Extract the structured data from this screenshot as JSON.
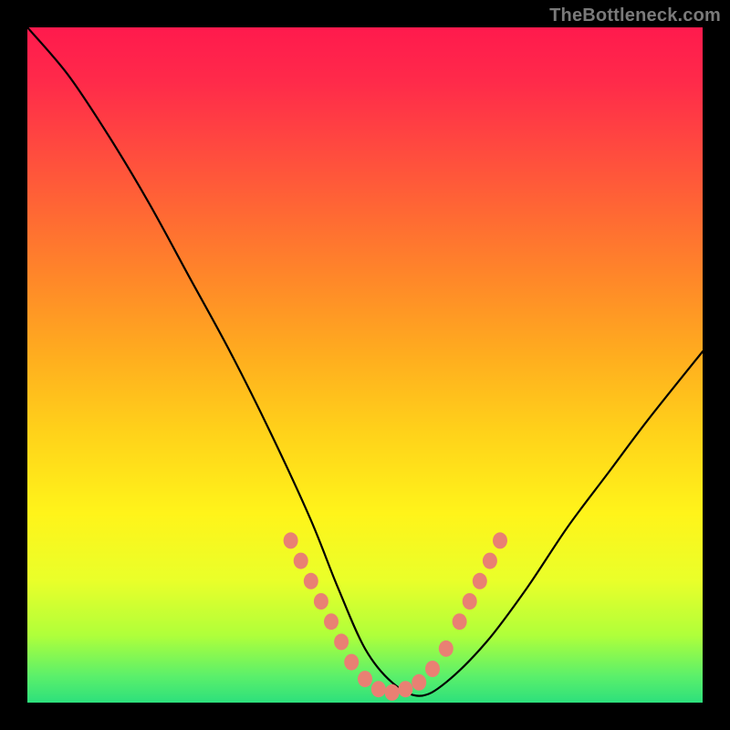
{
  "watermark": "TheBottleneck.com",
  "chart_data": {
    "type": "line",
    "title": "",
    "xlabel": "",
    "ylabel": "",
    "xlim": [
      0,
      100
    ],
    "ylim": [
      0,
      100
    ],
    "legend": false,
    "grid": false,
    "series": [
      {
        "name": "bottleneck-curve",
        "x": [
          0,
          6,
          12,
          18,
          24,
          30,
          36,
          42,
          46,
          50,
          54,
          58,
          62,
          68,
          74,
          80,
          86,
          92,
          100
        ],
        "y": [
          100,
          93,
          84,
          74,
          63,
          52,
          40,
          27,
          17,
          8,
          3,
          1,
          3,
          9,
          17,
          26,
          34,
          42,
          52
        ]
      }
    ],
    "annotations": {
      "salmon_dots": {
        "description": "cluster of salmon-tinted dots near the trough",
        "points": [
          {
            "x": 39,
            "y": 24
          },
          {
            "x": 40.5,
            "y": 21
          },
          {
            "x": 42,
            "y": 18
          },
          {
            "x": 43.5,
            "y": 15
          },
          {
            "x": 45,
            "y": 12
          },
          {
            "x": 46.5,
            "y": 9
          },
          {
            "x": 48,
            "y": 6
          },
          {
            "x": 50,
            "y": 3.5
          },
          {
            "x": 52,
            "y": 2
          },
          {
            "x": 54,
            "y": 1.5
          },
          {
            "x": 56,
            "y": 2
          },
          {
            "x": 58,
            "y": 3
          },
          {
            "x": 60,
            "y": 5
          },
          {
            "x": 62,
            "y": 8
          },
          {
            "x": 64,
            "y": 12
          },
          {
            "x": 65.5,
            "y": 15
          },
          {
            "x": 67,
            "y": 18
          },
          {
            "x": 68.5,
            "y": 21
          },
          {
            "x": 70,
            "y": 24
          }
        ]
      }
    },
    "background_gradient": {
      "direction": "top-to-bottom",
      "stops": [
        {
          "pos": 0.0,
          "color": "#ff1a4d"
        },
        {
          "pos": 0.5,
          "color": "#ffc21c"
        },
        {
          "pos": 0.8,
          "color": "#fff41a"
        },
        {
          "pos": 1.0,
          "color": "#2de07c"
        }
      ]
    }
  }
}
